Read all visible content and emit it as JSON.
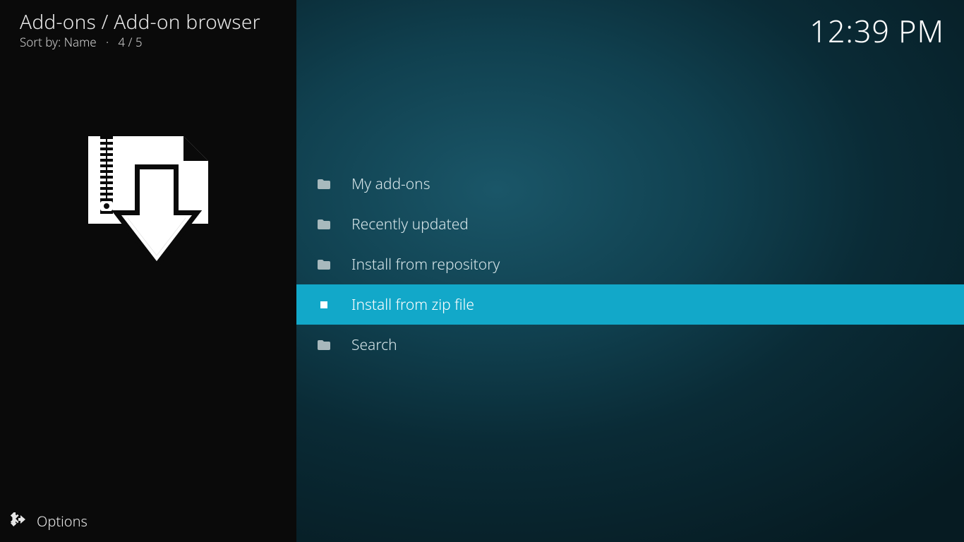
{
  "header": {
    "breadcrumb": "Add-ons / Add-on browser",
    "sort_label": "Sort by: Name",
    "position": "4 / 5",
    "separator": "·"
  },
  "clock": "12:39 PM",
  "options_label": "Options",
  "selected_index": 3,
  "menu": [
    {
      "icon": "folder",
      "label": "My add-ons"
    },
    {
      "icon": "folder",
      "label": "Recently updated"
    },
    {
      "icon": "folder",
      "label": "Install from repository"
    },
    {
      "icon": "zip",
      "label": "Install from zip file"
    },
    {
      "icon": "folder",
      "label": "Search"
    }
  ]
}
